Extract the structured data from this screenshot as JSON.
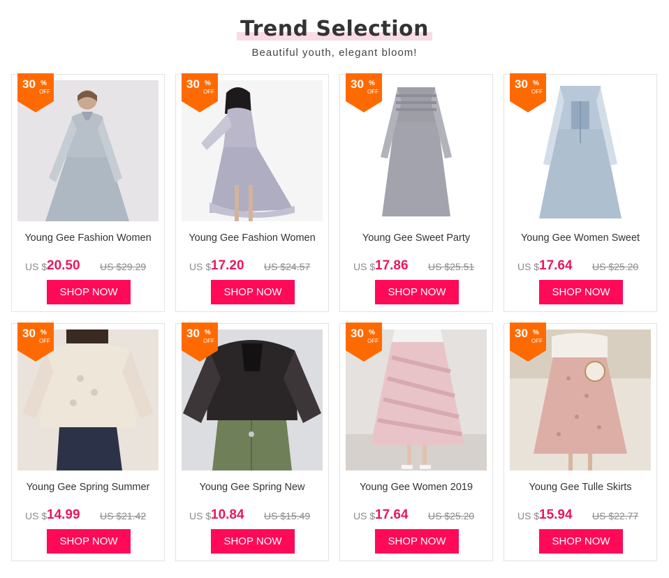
{
  "header": {
    "title": "Trend Selection",
    "subtitle": "Beautiful youth, elegant bloom!"
  },
  "colors": {
    "accent_pink": "#ff0a58",
    "price_pink": "#e8175d",
    "badge_orange": "#ff6a00",
    "title_underline": "#f7dce6"
  },
  "products": [
    {
      "name": "Young Gee Fashion Women",
      "currency": "US $",
      "price": "20.50",
      "old_price": "US $29.29",
      "discount": "30",
      "percent": "%",
      "off": "OFF",
      "button": "SHOP NOW",
      "image": "grey lace dress"
    },
    {
      "name": "Young Gee Fashion Women",
      "currency": "US $",
      "price": "17.20",
      "old_price": "US $24.57",
      "discount": "30",
      "percent": "%",
      "off": "OFF",
      "button": "SHOP NOW",
      "image": "grey ruffle dress"
    },
    {
      "name": "Young Gee Sweet Party",
      "currency": "US $",
      "price": "17.86",
      "old_price": "US $25.51",
      "discount": "30",
      "percent": "%",
      "off": "OFF",
      "button": "SHOP NOW",
      "image": "grey smocked dress"
    },
    {
      "name": "Young Gee Women Sweet",
      "currency": "US $",
      "price": "17.64",
      "old_price": "US $25.20",
      "discount": "30",
      "percent": "%",
      "off": "OFF",
      "button": "SHOP NOW",
      "image": "blue tulle dress"
    },
    {
      "name": "Young Gee Spring Summer",
      "currency": "US $",
      "price": "14.99",
      "old_price": "US $21.42",
      "discount": "30",
      "percent": "%",
      "off": "OFF",
      "button": "SHOP NOW",
      "image": "white lace blouse"
    },
    {
      "name": "Young Gee Spring New",
      "currency": "US $",
      "price": "10.84",
      "old_price": "US $15.49",
      "discount": "30",
      "percent": "%",
      "off": "OFF",
      "button": "SHOP NOW",
      "image": "black mesh blouse"
    },
    {
      "name": "Young Gee Women 2019",
      "currency": "US $",
      "price": "17.64",
      "old_price": "US $25.20",
      "discount": "30",
      "percent": "%",
      "off": "OFF",
      "button": "SHOP NOW",
      "image": "pink tulle skirt"
    },
    {
      "name": "Young Gee Tulle Skirts",
      "currency": "US $",
      "price": "15.94",
      "old_price": "US $22.77",
      "discount": "30",
      "percent": "%",
      "off": "OFF",
      "button": "SHOP NOW",
      "image": "pink dotted skirt"
    }
  ]
}
